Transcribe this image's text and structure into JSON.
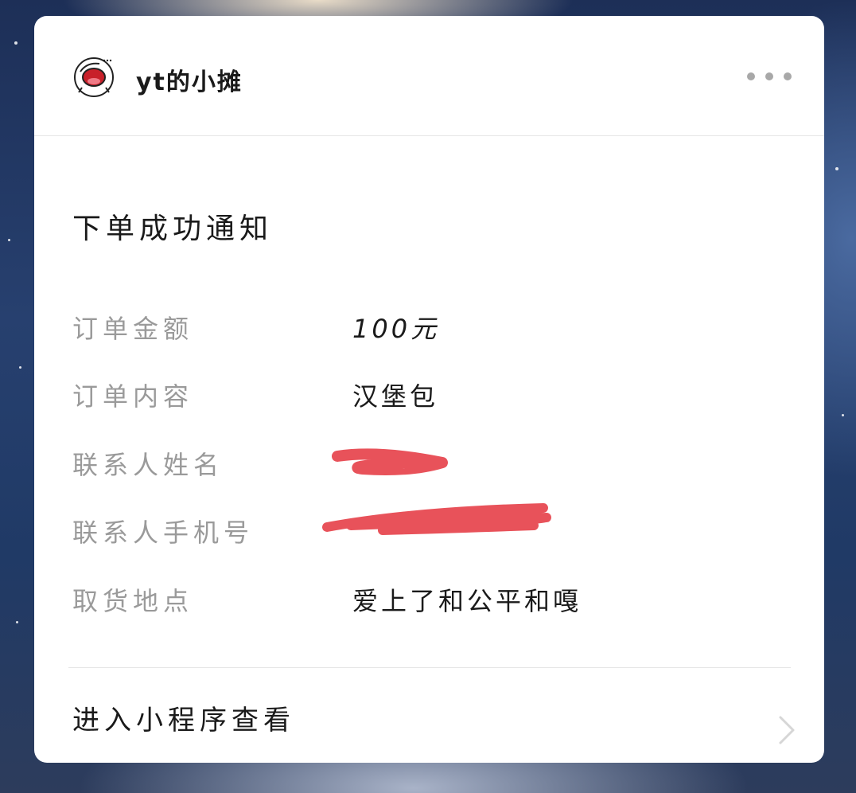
{
  "header": {
    "app_name": "yt的小摊",
    "avatar_icon": "cartoon-face-icon",
    "more_icon": "more-dots-icon"
  },
  "notice": {
    "title": "下单成功通知"
  },
  "fields": [
    {
      "label": "订单金额",
      "value": "100元"
    },
    {
      "label": "订单内容",
      "value": "汉堡包"
    },
    {
      "label": "联系人姓名",
      "value": ""
    },
    {
      "label": "联系人手机号",
      "value": ""
    },
    {
      "label": "取货地点",
      "value": "爱上了和公平和嘎"
    }
  ],
  "footer": {
    "link_label": "进入小程序查看",
    "chevron_icon": "chevron-right-icon"
  },
  "colors": {
    "label_gray": "#9a9a9a",
    "text_dark": "#1a1a1a",
    "redaction_red": "#e8525a",
    "divider": "#e6e6e6"
  }
}
